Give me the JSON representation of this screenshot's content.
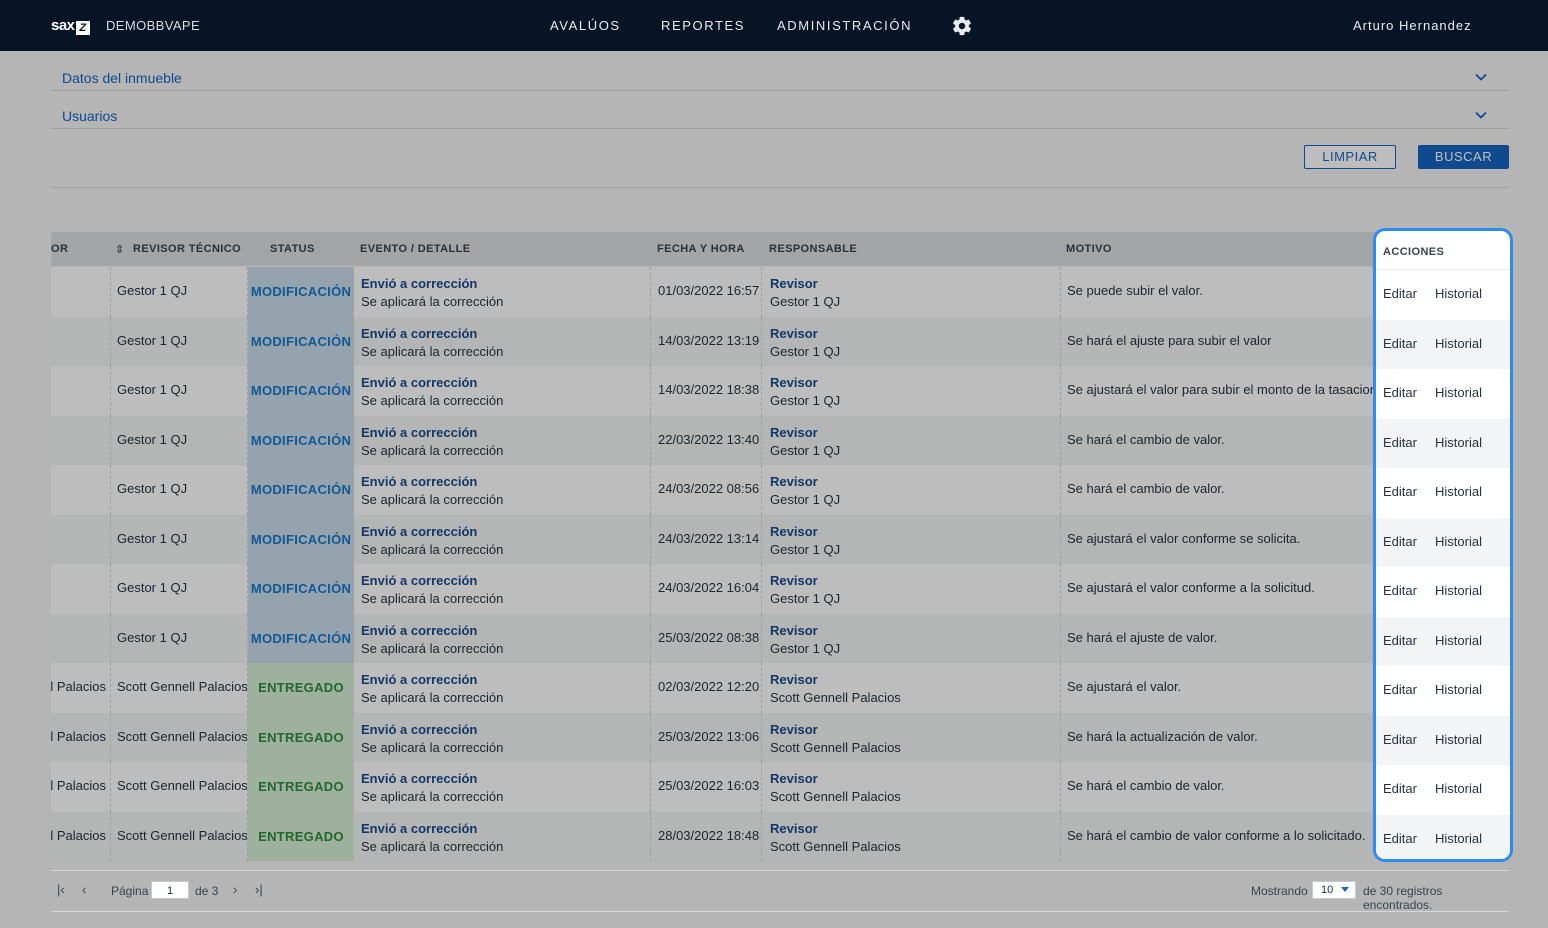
{
  "header": {
    "logo": "sax",
    "logo_mark": "Z",
    "client": "DEMOBBVAPE",
    "nav": [
      "AVALÚOS",
      "REPORTES",
      "ADMINISTRACIÓN"
    ],
    "user": "Arturo Hernandez"
  },
  "filters": {
    "section1": "Datos del inmueble",
    "section2": "Usuarios",
    "clear_label": "LIMPIAR",
    "search_label": "BUSCAR"
  },
  "table": {
    "headers": {
      "col1": "OR",
      "revisor": "REVISOR TÉCNICO",
      "status": "STATUS",
      "evento": "EVENTO / DETALLE",
      "fecha": "FECHA Y HORA",
      "responsable": "RESPONSABLE",
      "motivo": "MOTIVO",
      "acciones": "ACCIONES"
    },
    "edit_label": "Editar",
    "history_label": "Historial",
    "rows": [
      {
        "col1": "",
        "revisor": "Gestor 1 QJ",
        "status": "MODIFICACIÓN",
        "event": "Envió a corrección",
        "detail": "Se aplicará la corrección",
        "date": "01/03/2022 16:57",
        "role": "Revisor",
        "person": "Gestor 1 QJ",
        "motivo": "Se puede subir el valor."
      },
      {
        "col1": "",
        "revisor": "Gestor 1 QJ",
        "status": "MODIFICACIÓN",
        "event": "Envió a corrección",
        "detail": "Se aplicará la corrección",
        "date": "14/03/2022 13:19",
        "role": "Revisor",
        "person": "Gestor 1 QJ",
        "motivo": "Se hará el ajuste para subir el valor"
      },
      {
        "col1": "",
        "revisor": "Gestor 1 QJ",
        "status": "MODIFICACIÓN",
        "event": "Envió a corrección",
        "detail": "Se aplicará la corrección",
        "date": "14/03/2022 18:38",
        "role": "Revisor",
        "person": "Gestor 1 QJ",
        "motivo": "Se ajustará el valor para subir el monto de la tasacion"
      },
      {
        "col1": "",
        "revisor": "Gestor 1 QJ",
        "status": "MODIFICACIÓN",
        "event": "Envió a corrección",
        "detail": "Se aplicará la corrección",
        "date": "22/03/2022 13:40",
        "role": "Revisor",
        "person": "Gestor 1 QJ",
        "motivo": "Se hará el cambio de valor."
      },
      {
        "col1": "",
        "revisor": "Gestor 1 QJ",
        "status": "MODIFICACIÓN",
        "event": "Envió a corrección",
        "detail": "Se aplicará la corrección",
        "date": "24/03/2022 08:56",
        "role": "Revisor",
        "person": "Gestor 1 QJ",
        "motivo": "Se hará el cambio de valor."
      },
      {
        "col1": "",
        "revisor": "Gestor 1 QJ",
        "status": "MODIFICACIÓN",
        "event": "Envió a corrección",
        "detail": "Se aplicará la corrección",
        "date": "24/03/2022 13:14",
        "role": "Revisor",
        "person": "Gestor 1 QJ",
        "motivo": "Se ajustará el valor conforme se solicita."
      },
      {
        "col1": "",
        "revisor": "Gestor 1 QJ",
        "status": "MODIFICACIÓN",
        "event": "Envió a corrección",
        "detail": "Se aplicará la corrección",
        "date": "24/03/2022 16:04",
        "role": "Revisor",
        "person": "Gestor 1 QJ",
        "motivo": "Se ajustará el valor conforme a la solicitud."
      },
      {
        "col1": "",
        "revisor": "Gestor 1 QJ",
        "status": "MODIFICACIÓN",
        "event": "Envió a corrección",
        "detail": "Se aplicará la corrección",
        "date": "25/03/2022 08:38",
        "role": "Revisor",
        "person": "Gestor 1 QJ",
        "motivo": "Se hará el ajuste de valor."
      },
      {
        "col1": "l Palacios",
        "revisor": "Scott Gennell Palacios",
        "status": "ENTREGADO",
        "event": "Envió a corrección",
        "detail": "Se aplicará la corrección",
        "date": "02/03/2022 12:20",
        "role": "Revisor",
        "person": "Scott Gennell Palacios",
        "motivo": "Se ajustará el valor."
      },
      {
        "col1": "l Palacios",
        "revisor": "Scott Gennell Palacios",
        "status": "ENTREGADO",
        "event": "Envió a corrección",
        "detail": "Se aplicará la corrección",
        "date": "25/03/2022 13:06",
        "role": "Revisor",
        "person": "Scott Gennell Palacios",
        "motivo": "Se hará la actualización de valor."
      },
      {
        "col1": "l Palacios",
        "revisor": "Scott Gennell Palacios",
        "status": "ENTREGADO",
        "event": "Envió a corrección",
        "detail": "Se aplicará la corrección",
        "date": "25/03/2022 16:03",
        "role": "Revisor",
        "person": "Scott Gennell Palacios",
        "motivo": "Se hará el cambio de valor."
      },
      {
        "col1": "l Palacios",
        "revisor": "Scott Gennell Palacios",
        "status": "ENTREGADO",
        "event": "Envió a corrección",
        "detail": "Se aplicará la corrección",
        "date": "28/03/2022 18:48",
        "role": "Revisor",
        "person": "Scott Gennell Palacios",
        "motivo": "Se hará el cambio de valor conforme a lo solicitado."
      }
    ]
  },
  "pagination": {
    "page_label": "Página",
    "current_page": "1",
    "of_label": "de 3",
    "showing_label": "Mostrando",
    "page_size": "10",
    "records_label": "de 30 registros encontrados."
  },
  "colors": {
    "topbar": "#071425",
    "accent": "#1565c0",
    "highlight": "#2d8cf0",
    "status_mod": "#1877c9",
    "status_ent": "#2e8b3a"
  }
}
